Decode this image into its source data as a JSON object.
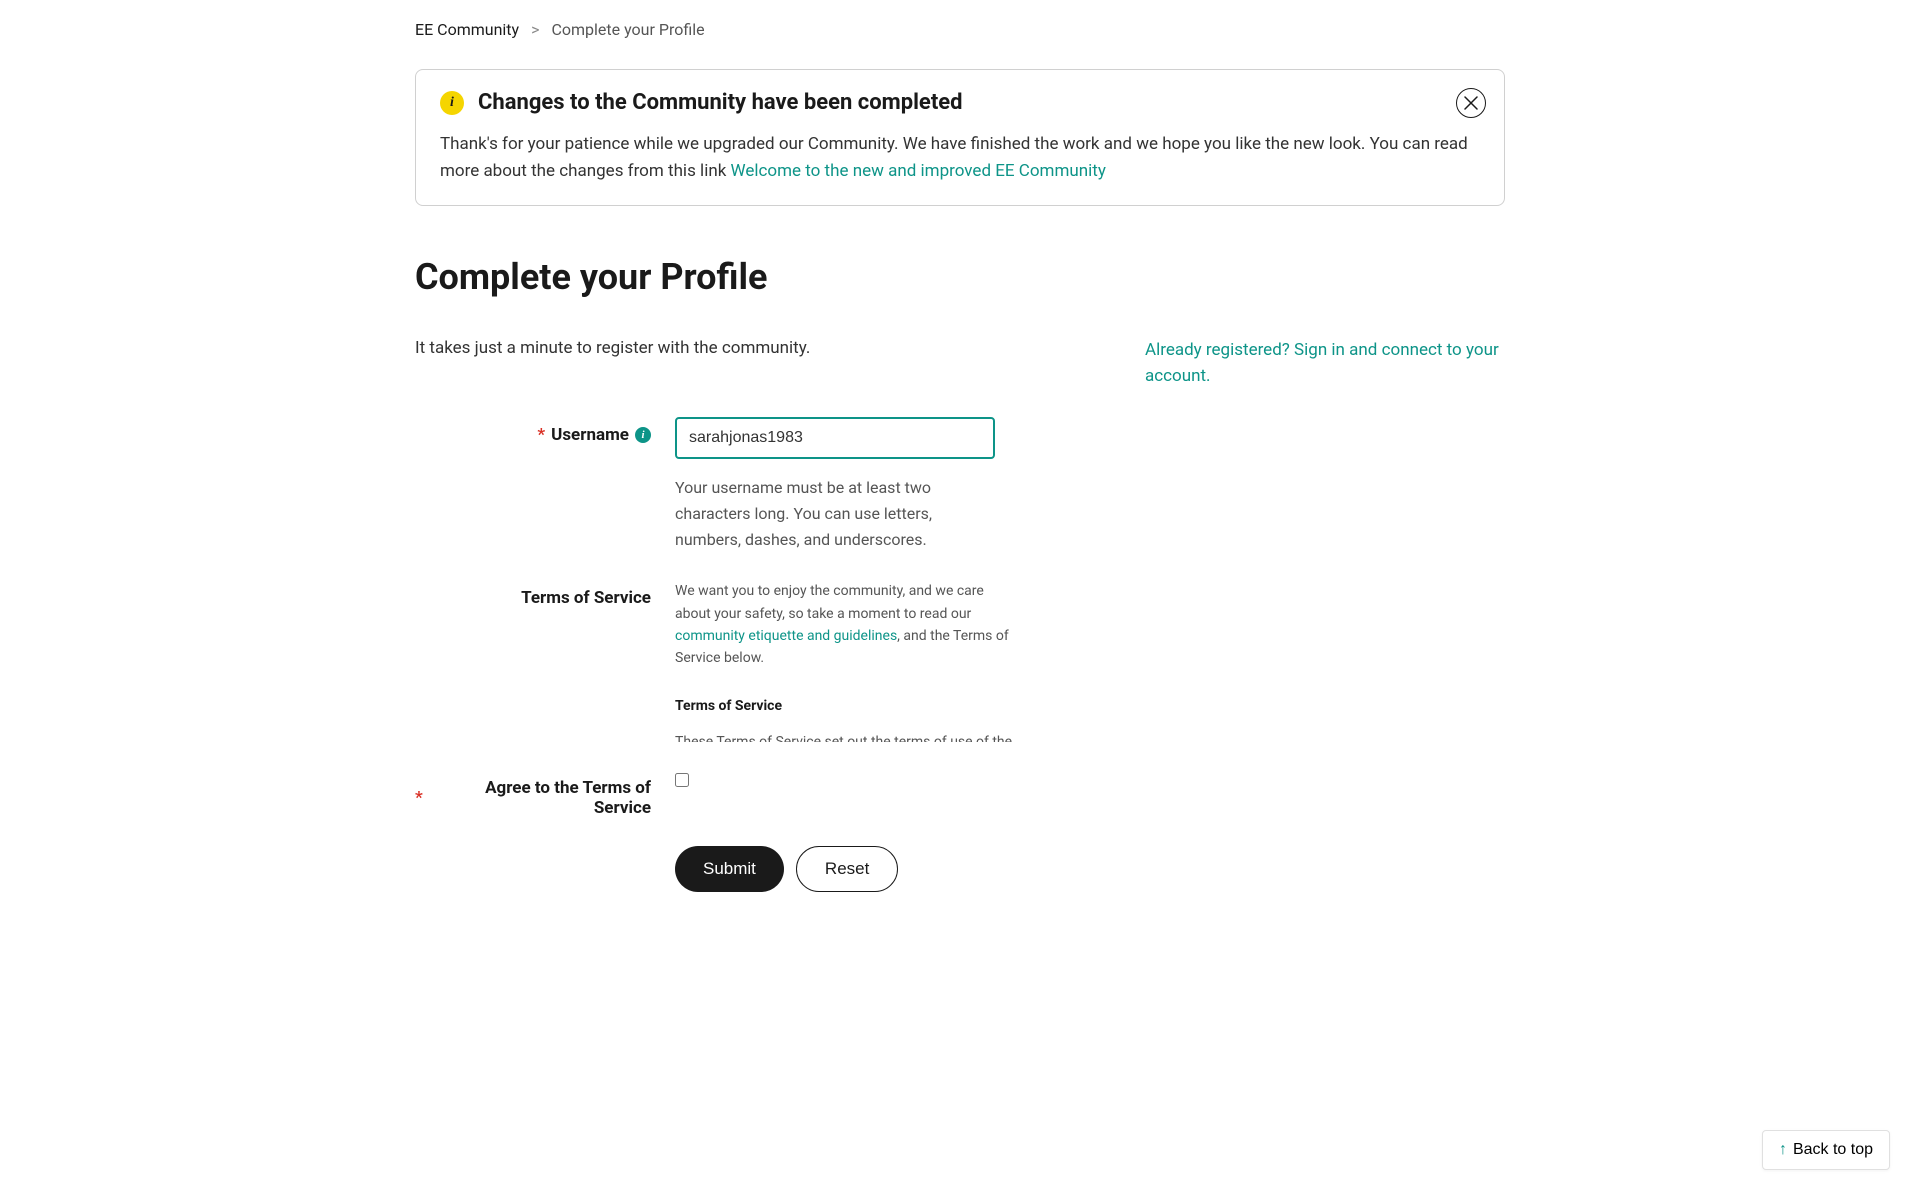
{
  "breadcrumb": {
    "home": "EE Community",
    "separator": ">",
    "current": "Complete your Profile"
  },
  "notification": {
    "title": "Changes to the Community have been completed",
    "body_part1": "Thank's for your patience while we upgraded our Community. We have finished the work and we hope you like the new look. You can read more about the changes from this link ",
    "link_text": "Welcome to the new and improved EE Community"
  },
  "page": {
    "title": "Complete your Profile",
    "subtitle": "It takes just a minute to register with the community.",
    "signin_text": "Already registered? Sign in and connect to your account."
  },
  "form": {
    "username_label": "Username",
    "username_value": "sarahjonas1983",
    "username_hint": "Your username must be at least two characters long. You can use letters, numbers, dashes, and underscores.",
    "terms_label": "Terms of Service",
    "terms_intro_part1": "We want you to enjoy the community, and we care about your safety, so take a moment to read our ",
    "terms_intro_link": "community etiquette and guidelines",
    "terms_intro_part2": ", and the Terms of Service below.",
    "terms_heading": "Terms of Service",
    "terms_body_start": "These Terms of Service set out the terms of use of the",
    "agree_label": "Agree to the Terms of Service",
    "submit_label": "Submit",
    "reset_label": "Reset"
  },
  "back_to_top": "Back to top"
}
